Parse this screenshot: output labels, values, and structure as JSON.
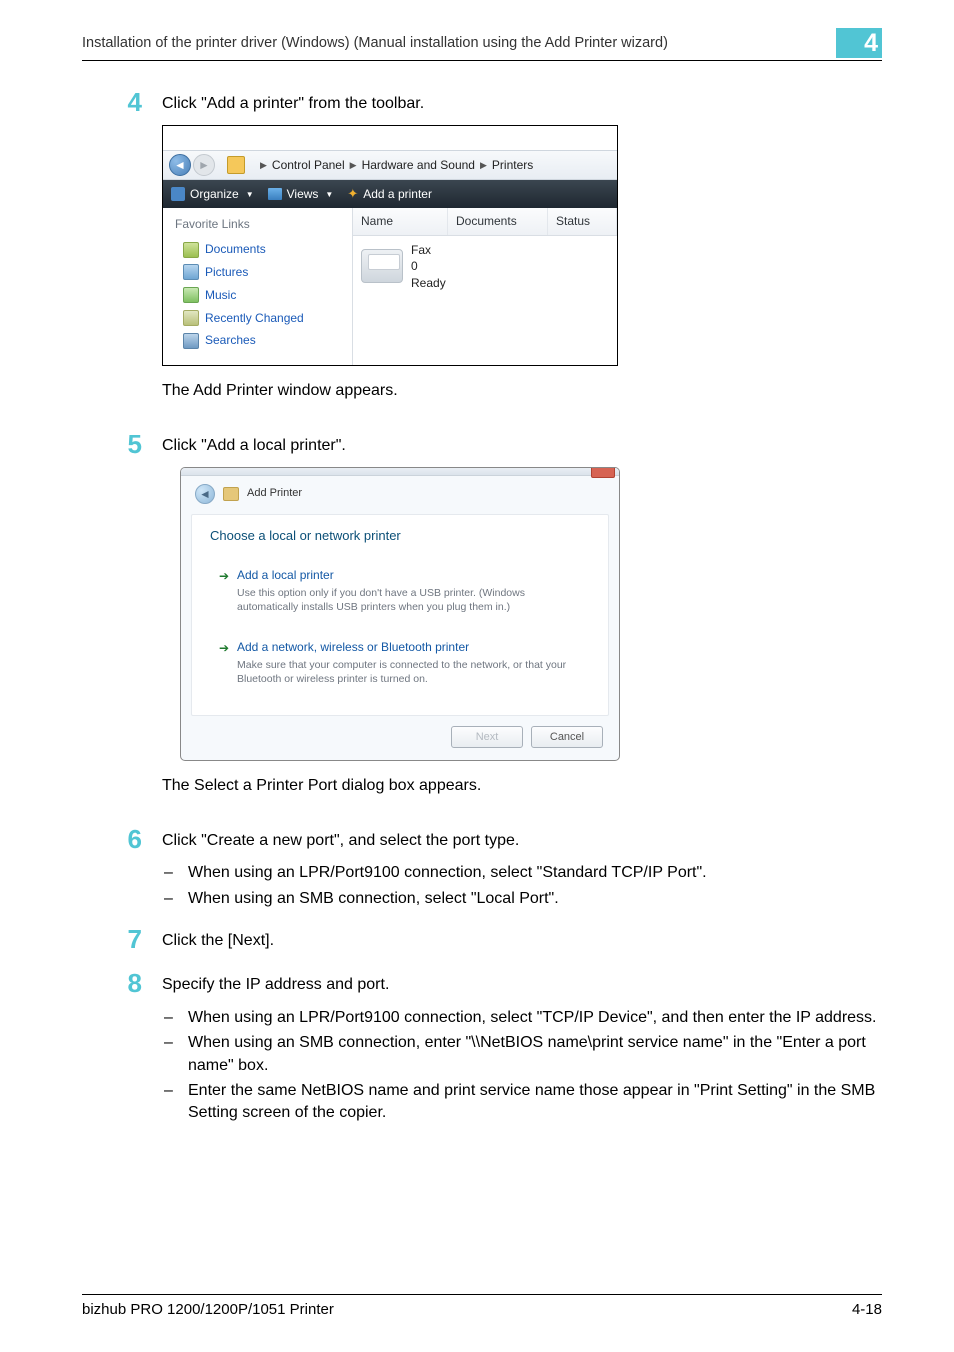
{
  "header": {
    "title": "Installation of the printer driver (Windows) (Manual installation using the Add Printer wizard)",
    "chapter": "4"
  },
  "steps": {
    "s4": {
      "text": "Click \"Add a printer\" from the toolbar.",
      "caption": "The Add Printer window appears."
    },
    "s5": {
      "text": "Click \"Add a local printer\".",
      "caption": "The Select a Printer Port dialog box appears."
    },
    "s6": {
      "text": "Click \"Create a new port\", and select the port type.",
      "b1": "When using an LPR/Port9100 connection, select \"Standard TCP/IP Port\".",
      "b2": "When using an SMB connection, select \"Local Port\"."
    },
    "s7": {
      "text": "Click the [Next]."
    },
    "s8": {
      "text": "Specify the IP address and port.",
      "b1": "When using an LPR/Port9100 connection, select \"TCP/IP Device\", and then enter the IP address.",
      "b2": "When using an SMB connection, enter \"\\\\NetBIOS name\\print service name\" in the \"Enter a port name\" box.",
      "b3": "Enter the same NetBIOS name and print service name those appear in \"Print Setting\" in the SMB Setting screen of the copier."
    }
  },
  "shot1": {
    "crumb1": "Control Panel",
    "crumb2": "Hardware and Sound",
    "crumb3": "Printers",
    "organize": "Organize",
    "views": "Views",
    "add": "Add a printer",
    "fav_hdr": "Favorite Links",
    "docs": "Documents",
    "pics": "Pictures",
    "music": "Music",
    "recent": "Recently Changed",
    "search": "Searches",
    "col_name": "Name",
    "col_docs": "Documents",
    "col_status": "Status",
    "fax": "Fax",
    "zero": "0",
    "ready": "Ready"
  },
  "shot2": {
    "title": "Add Printer",
    "question": "Choose a local or network printer",
    "opt1_t": "Add a local printer",
    "opt1_d": "Use this option only if you don't have a USB printer. (Windows automatically installs USB printers when you plug them in.)",
    "opt2_t": "Add a network, wireless or Bluetooth printer",
    "opt2_d": "Make sure that your computer is connected to the network, or that your Bluetooth or wireless printer is turned on.",
    "next": "Next",
    "cancel": "Cancel"
  },
  "footer": {
    "left": "bizhub PRO 1200/1200P/1051 Printer",
    "right": "4-18"
  }
}
